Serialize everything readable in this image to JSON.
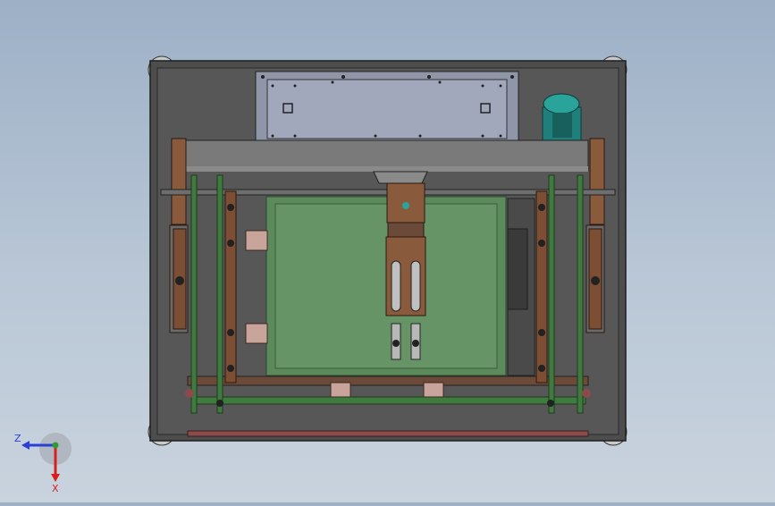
{
  "viewport": {
    "background_top": "#9db0c6",
    "background_bottom": "#c9d3de"
  },
  "model": {
    "frame_color": "#4a4a4a",
    "plate_color": "#8f96a8",
    "panel_color": "#5c8a5c",
    "bracket_color": "#8a5a3c",
    "rail_color": "#3f7a3f",
    "motor_color": "#1f7f7a"
  },
  "triad": {
    "z_label": "Z",
    "x_label": "X",
    "z_color": "#2b3fd6",
    "x_color": "#d61f1f",
    "y_color": "#2ca02c"
  }
}
